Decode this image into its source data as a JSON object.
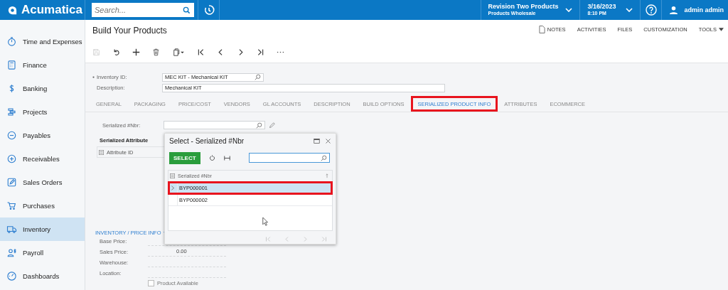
{
  "brand": "Acumatica",
  "search": {
    "placeholder": "Search..."
  },
  "company": {
    "name": "Revision Two Products",
    "branch": "Products Wholesale"
  },
  "session": {
    "date": "3/16/2023",
    "time": "8:10 PM"
  },
  "user": {
    "name": "admin admin"
  },
  "sidebar": {
    "items": [
      {
        "label": "Time and Expenses",
        "selected": false
      },
      {
        "label": "Finance",
        "selected": false
      },
      {
        "label": "Banking",
        "selected": false
      },
      {
        "label": "Projects",
        "selected": false
      },
      {
        "label": "Payables",
        "selected": false
      },
      {
        "label": "Receivables",
        "selected": false
      },
      {
        "label": "Sales Orders",
        "selected": false
      },
      {
        "label": "Purchases",
        "selected": false
      },
      {
        "label": "Inventory",
        "selected": true
      },
      {
        "label": "Payroll",
        "selected": false
      },
      {
        "label": "Dashboards",
        "selected": false
      }
    ]
  },
  "page": {
    "title": "Build Your Products"
  },
  "top_links": [
    "NOTES",
    "ACTIVITIES",
    "FILES",
    "CUSTOMIZATION",
    "TOOLS"
  ],
  "form": {
    "fields": [
      {
        "label": "Inventory ID:",
        "required": true,
        "value": "MEC KIT - Mechanical KIT",
        "lookup": true
      },
      {
        "label": "Description:",
        "required": false,
        "value": "Mechanical KIT",
        "lookup": false
      }
    ]
  },
  "tabs": [
    {
      "label": "GENERAL",
      "selected": false
    },
    {
      "label": "PACKAGING",
      "selected": false
    },
    {
      "label": "PRICE/COST",
      "selected": false
    },
    {
      "label": "VENDORS",
      "selected": false
    },
    {
      "label": "GL ACCOUNTS",
      "selected": false
    },
    {
      "label": "DESCRIPTION",
      "selected": false
    },
    {
      "label": "BUILD OPTIONS",
      "selected": false
    },
    {
      "label": "SERIALIZED PRODUCT INFO",
      "selected": true
    },
    {
      "label": "ATTRIBUTES",
      "selected": false
    },
    {
      "label": "ECOMMERCE",
      "selected": false
    }
  ],
  "serial_field": {
    "label": "Serialized #Nbr:"
  },
  "attributes_grid": {
    "title": "Serialized Attribute",
    "column": "Attribute ID"
  },
  "inventory_section": {
    "title": "INVENTORY / PRICE INFO",
    "rows": [
      {
        "label": "Base Price:",
        "value": ""
      },
      {
        "label": "Sales Price:",
        "value": "0.00"
      },
      {
        "label": "Warehouse:",
        "value": ""
      },
      {
        "label": "Location:",
        "value": ""
      }
    ],
    "checkbox": {
      "label": "Product Available",
      "checked": false
    }
  },
  "dialog": {
    "title": "Select - Serialized #Nbr",
    "button": "SELECT",
    "column": "Serialized #Nbr",
    "rows": [
      {
        "value": "BYP000001",
        "selected": true
      },
      {
        "value": "BYP000002",
        "selected": false
      }
    ]
  }
}
